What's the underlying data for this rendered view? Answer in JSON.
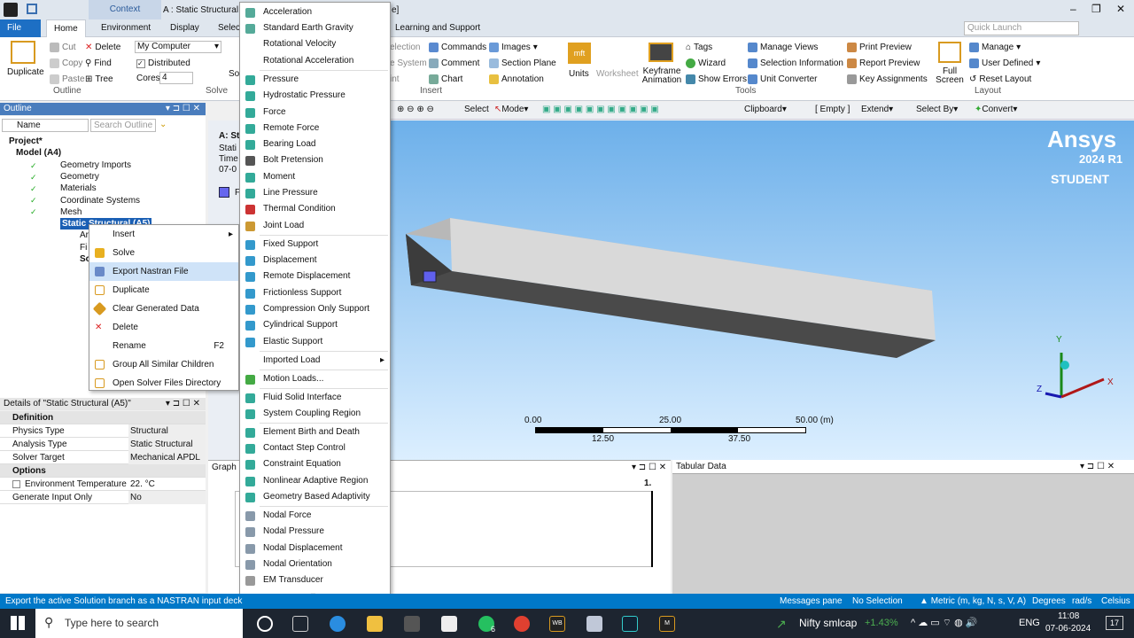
{
  "titlebar": {
    "context": "Context",
    "doc_title": "A : Static Structural",
    "fragment": "e]"
  },
  "tabs": {
    "file": "File",
    "home": "Home",
    "environment": "Environment",
    "display": "Display",
    "selec": "Selec",
    "learning": "Learning and Support"
  },
  "quick_launch": "Quick Launch",
  "ribbon": {
    "duplicate": "Duplicate",
    "cut": "Cut",
    "copy": "Copy",
    "paste": "Paste",
    "delete": "Delete",
    "find": "Find",
    "tree": "Tree",
    "outline_grp": "Outline",
    "solver_select": "My Computer",
    "distributed": "Distributed",
    "cores_label": "Cores",
    "cores_value": "4",
    "solve_grp": "Solve",
    "so": "So",
    "selection": "election",
    "system": "e System",
    "int": "int",
    "commands": "Commands",
    "comment": "Comment",
    "chart": "Chart",
    "images": "Images",
    "section_plane": "Section Plane",
    "annotation": "Annotation",
    "insert_grp": "Insert",
    "units": "Units",
    "worksheet": "Worksheet",
    "keyframe": "Keyframe Animation",
    "tags": "Tags",
    "wizard": "Wizard",
    "show_errors": "Show Errors",
    "manage_views": "Manage Views",
    "selection_info": "Selection Information",
    "unit_converter": "Unit Converter",
    "tools_grp": "Tools",
    "print_preview": "Print Preview",
    "report_preview": "Report Preview",
    "key_assignments": "Key Assignments",
    "full_screen": "Full Screen",
    "manage": "Manage",
    "user_defined": "User Defined",
    "reset_layout": "Reset Layout",
    "layout_grp": "Layout"
  },
  "toolbar": {
    "select": "Select",
    "mode": "Mode",
    "clipboard": "Clipboard",
    "empty": "[ Empty ]",
    "extend": "Extend",
    "select_by": "Select By",
    "convert": "Convert"
  },
  "outline": {
    "title": "Outline",
    "name_col": "Name",
    "search_placeholder": "Search Outline",
    "items": [
      "Project*",
      "Model (A4)",
      "Geometry Imports",
      "Geometry",
      "Materials",
      "Coordinate Systems",
      "Mesh",
      "Static Structural (A5)",
      "Ar",
      "Fi",
      "So"
    ]
  },
  "info_panel": {
    "title": "A: St",
    "l1": "Stati",
    "l2": "Time",
    "l3": "07-0",
    "l4": "F"
  },
  "context_menu": {
    "items": [
      "Insert",
      "Solve",
      "Export Nastran File",
      "Duplicate",
      "Clear Generated Data",
      "Delete",
      "Rename",
      "Group All Similar Children",
      "Open Solver Files Directory"
    ],
    "rename_shortcut": "F2"
  },
  "submenu": {
    "items": [
      "Acceleration",
      "Standard Earth Gravity",
      "Rotational Velocity",
      "Rotational Acceleration",
      "Pressure",
      "Hydrostatic Pressure",
      "Force",
      "Remote Force",
      "Bearing Load",
      "Bolt Pretension",
      "Moment",
      "Line Pressure",
      "Thermal Condition",
      "Joint Load",
      "Fixed Support",
      "Displacement",
      "Remote Displacement",
      "Frictionless Support",
      "Compression Only Support",
      "Cylindrical Support",
      "Elastic Support",
      "Imported Load",
      "Motion Loads...",
      "Fluid Solid Interface",
      "System Coupling Region",
      "Element Birth and Death",
      "Contact Step Control",
      "Constraint Equation",
      "Nonlinear Adaptive Region",
      "Geometry Based Adaptivity",
      "Nodal Force",
      "Nodal Pressure",
      "Nodal Displacement",
      "Nodal Orientation",
      "EM Transducer"
    ]
  },
  "viewport": {
    "brand": "Ansys",
    "version": "2024 R1",
    "edition": "STUDENT",
    "scale": [
      "0.00",
      "25.00",
      "50.00 (m)",
      "12.50",
      "37.50"
    ],
    "axis_x": "X",
    "axis_y": "Y",
    "axis_z": "Z"
  },
  "details": {
    "title": "Details of \"Static Structural (A5)\"",
    "definition": "Definition",
    "options": "Options",
    "rows": [
      [
        "Physics Type",
        "Structural"
      ],
      [
        "Analysis Type",
        "Static Structural"
      ],
      [
        "Solver Target",
        "Mechanical APDL"
      ]
    ],
    "opt_rows": [
      [
        "Environment Temperature",
        "22. °C"
      ],
      [
        "Generate Input Only",
        "No"
      ]
    ]
  },
  "graph": {
    "title": "Graph",
    "marker": "1."
  },
  "tabular": {
    "title": "Tabular Data"
  },
  "status": {
    "message": "Export the active Solution branch as a NASTRAN input deck",
    "messages_pane": "Messages pane",
    "no_selection": "No Selection",
    "metric": "Metric (m, kg, N, s, V, A)",
    "degrees": "Degrees",
    "rads": "rad/s",
    "celsius": "Celsius"
  },
  "taskbar": {
    "search": "Type here to search",
    "wb": "WB",
    "m": "M",
    "badge": "6",
    "nifty": "Nifty smlcap",
    "nifty_change": "+1.43%",
    "lang": "ENG",
    "time": "11:08",
    "date": "07-06-2024",
    "notif": "17"
  }
}
